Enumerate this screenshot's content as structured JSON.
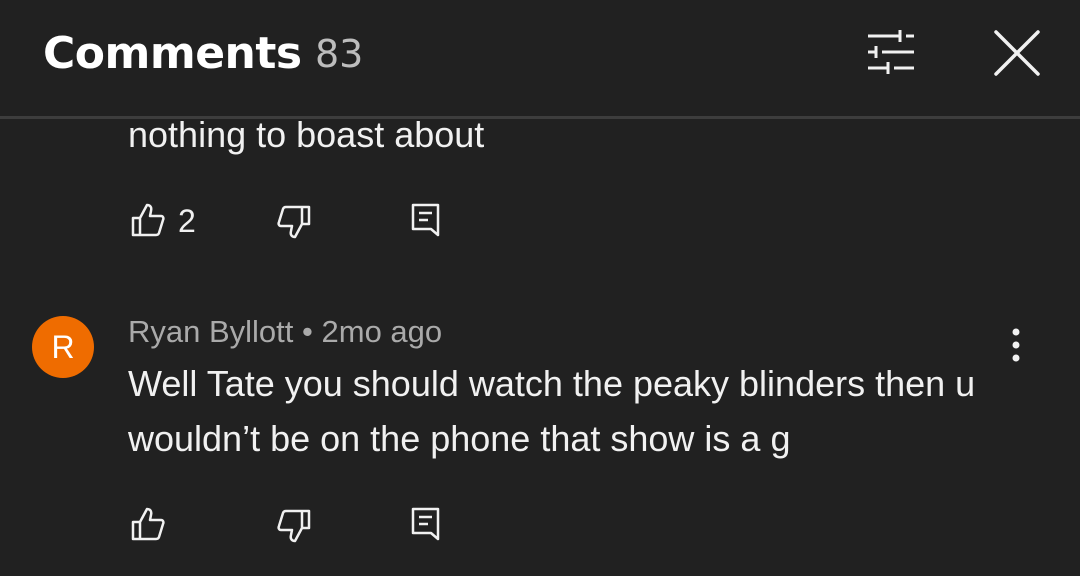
{
  "header": {
    "title": "Comments",
    "count": "83",
    "filter_icon": "filter-sliders-icon",
    "close_icon": "close-icon"
  },
  "comments": [
    {
      "text_fragment": "nothing to boast about",
      "like_count": "2"
    },
    {
      "avatar_letter": "R",
      "author": "Ryan Byllott",
      "separator": "•",
      "time": "2mo ago",
      "text_line1": "Well Tate you should watch the peaky blinders then u",
      "text_line2": "wouldn’t be on the phone that show is a g"
    }
  ],
  "colors": {
    "background": "#212121",
    "avatar": "#ef6c00",
    "secondary_text": "#aaaaaa"
  }
}
